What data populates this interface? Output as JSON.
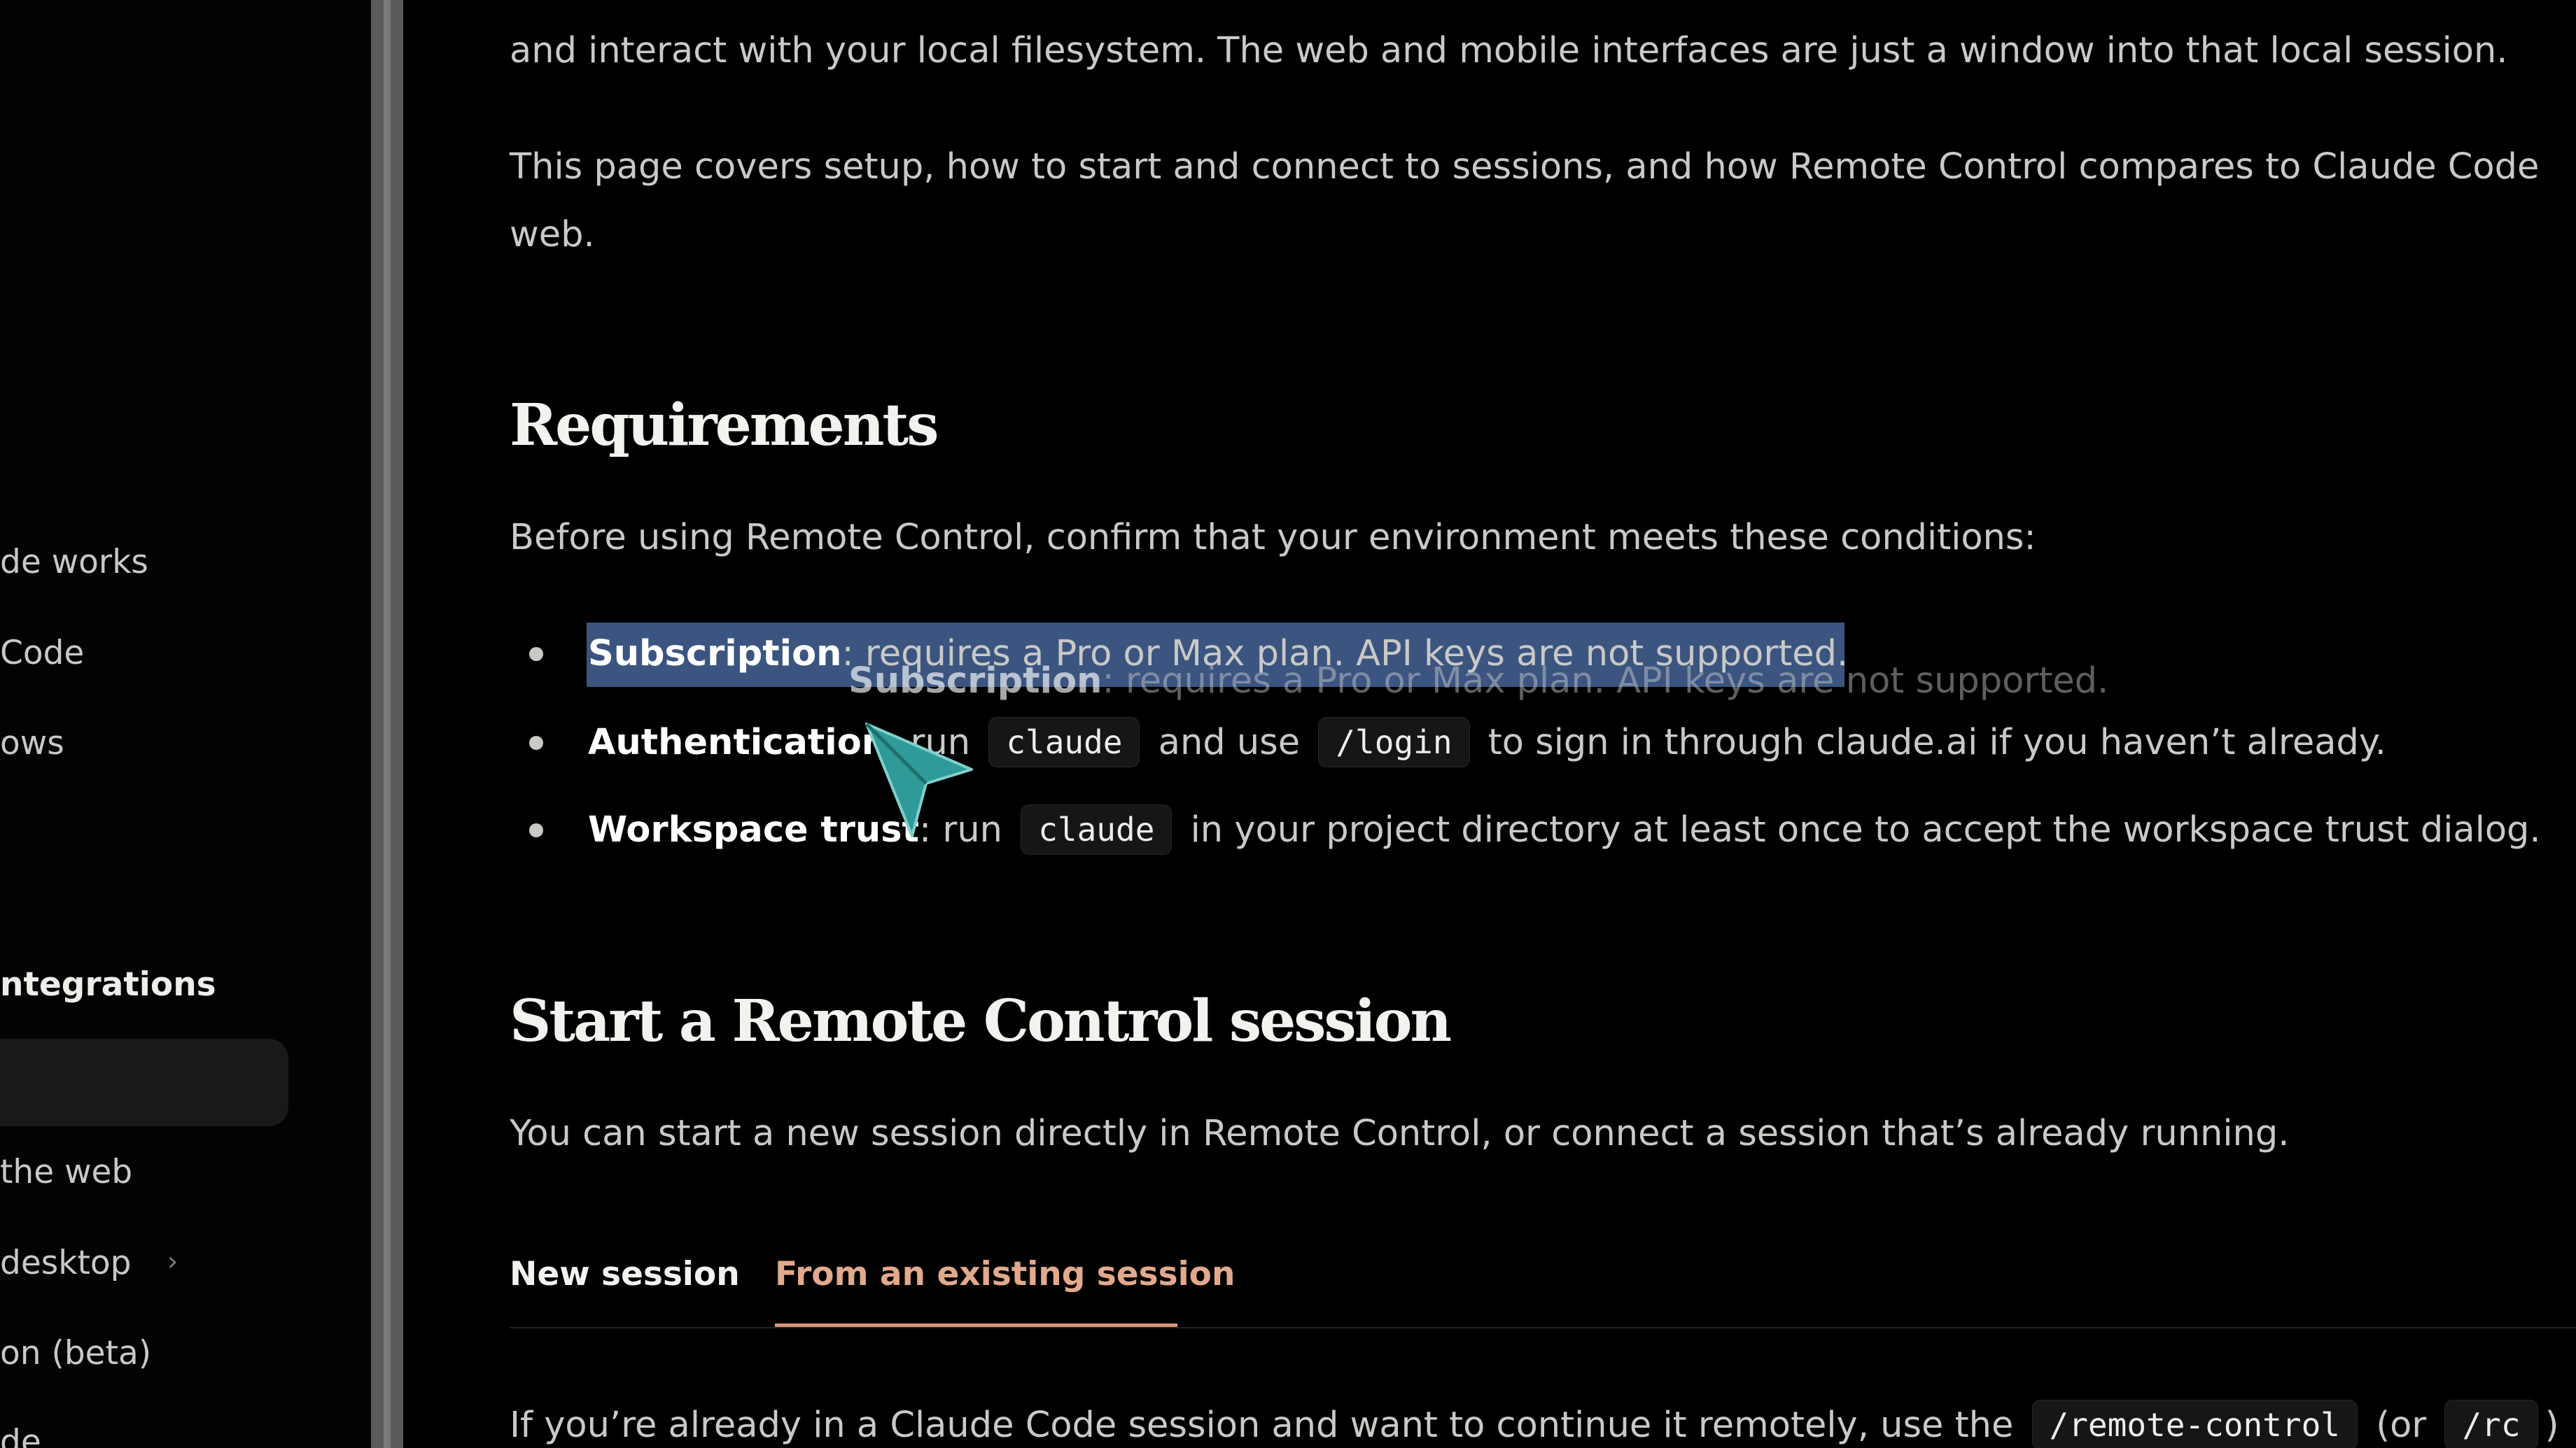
{
  "sidebar": {
    "items_top": [
      {
        "label": "de works"
      },
      {
        "label": "Code"
      },
      {
        "label": "ows"
      }
    ],
    "section_heading": "ntegrations",
    "items_bottom": [
      {
        "label": "the web"
      },
      {
        "label": "desktop"
      },
      {
        "label": "on (beta)"
      },
      {
        "label": "de"
      }
    ],
    "chevron": "›"
  },
  "main": {
    "intro_line": "and interact with your local filesystem. The web and mobile interfaces are just a window into that local session.",
    "intro_para_line1": "This page covers setup, how to start and connect to sessions, and how Remote Control compares to Claude Code",
    "intro_para_line2": "web.",
    "requirements": {
      "heading": "Requirements",
      "lead": "Before using Remote Control, confirm that your environment meets these conditions:",
      "bullets": [
        {
          "term": "Subscription",
          "rest": ": requires a Pro or Max plan. API keys are not supported."
        },
        {
          "term": "Authentication",
          "text1": ": run",
          "code1": "claude",
          "text2": "and use",
          "code2": "/login",
          "text3": "to sign in through claude.ai if you haven’t already."
        },
        {
          "term": "Workspace trust",
          "text1": ": run",
          "code1": "claude",
          "text2": "in your project directory at least once to accept the workspace trust dialog."
        }
      ],
      "drag_ghost": {
        "term": "Subscription",
        "rest": ": requires a Pro or Max plan. API keys are not supported."
      }
    },
    "start_session": {
      "heading": "Start a Remote Control session",
      "lead": "You can start a new session directly in Remote Control, or connect a session that’s already running.",
      "tabs": [
        {
          "label": "New session",
          "active": false
        },
        {
          "label": "From an existing session",
          "active": true
        }
      ],
      "body_text1": "If you’re already in a Claude Code session and want to continue it remotely, use the",
      "body_code1": "/remote-control",
      "body_text2": "(or",
      "body_code2": "/rc",
      "body_text3": ")"
    }
  },
  "colors": {
    "background": "#000000",
    "accent_tab": "#e3a98c",
    "selection": "#3b5580",
    "cursor": "#2f9a98"
  }
}
